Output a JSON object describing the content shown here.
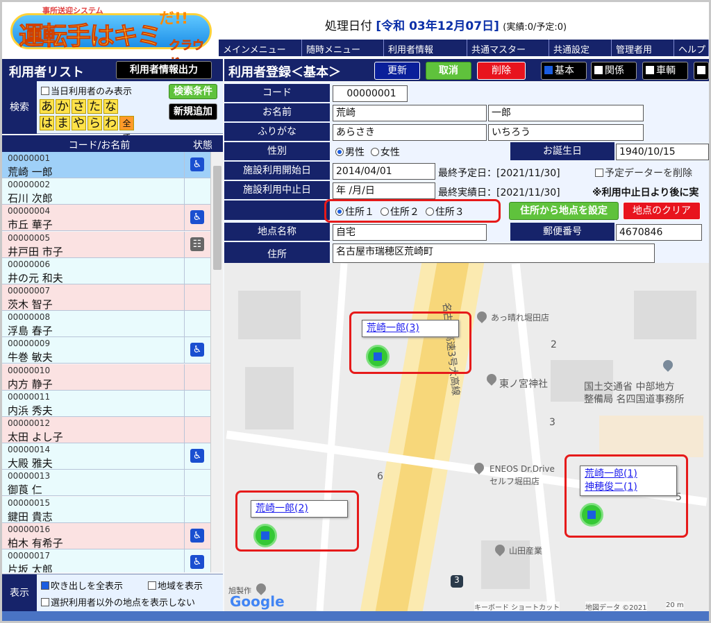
{
  "header": {
    "logo_sub": "事所送迎システム",
    "logo_main": "運転手はキミ",
    "logo_da": "だ!!",
    "logo_cloud": "クラウド",
    "date_label": "処理日付",
    "date_value": "[令和 03年12月07日]",
    "date_stats": "(実績:0/予定:0)"
  },
  "menu": [
    "メインメニュー",
    "随時メニュー",
    "利用者情報",
    "共通マスター",
    "共通設定",
    "管理者用",
    "ヘルプ"
  ],
  "left": {
    "title": "利用者リスト",
    "export_button": "利用者情報出力",
    "search_label": "検索",
    "today_only": "当日利用者のみ表示",
    "kana_row1": [
      "あ",
      "か",
      "さ",
      "た",
      "な"
    ],
    "kana_row2": [
      "は",
      "ま",
      "や",
      "ら",
      "わ",
      "全て"
    ],
    "search_cond_button": "検索条件",
    "new_add_button": "新規追加",
    "col_code_name": "コード/お名前",
    "col_status": "状態",
    "users": [
      {
        "code": "00000001",
        "name": "荒崎 一郎",
        "status": "wheelchair"
      },
      {
        "code": "00000002",
        "name": "石川 次郎",
        "status": ""
      },
      {
        "code": "00000004",
        "name": "市丘 華子",
        "status": "wheelchair"
      },
      {
        "code": "00000005",
        "name": "井戸田 市子",
        "status": "walker"
      },
      {
        "code": "00000006",
        "name": "井の元 和夫",
        "status": ""
      },
      {
        "code": "00000007",
        "name": "茨木 智子",
        "status": ""
      },
      {
        "code": "00000008",
        "name": "浮島 春子",
        "status": ""
      },
      {
        "code": "00000009",
        "name": "牛巻 敏夫",
        "status": "wheelchair"
      },
      {
        "code": "00000010",
        "name": "内方 静子",
        "status": ""
      },
      {
        "code": "00000011",
        "name": "内浜 秀夫",
        "status": ""
      },
      {
        "code": "00000012",
        "name": "太田 よし子",
        "status": ""
      },
      {
        "code": "00000014",
        "name": "大殿 雅夫",
        "status": "wheelchair"
      },
      {
        "code": "00000013",
        "name": "御莨 仁",
        "status": ""
      },
      {
        "code": "00000015",
        "name": "鍵田 貴志",
        "status": ""
      },
      {
        "code": "00000016",
        "name": "柏木 有希子",
        "status": "wheelchair"
      },
      {
        "code": "00000017",
        "name": "片坂 太郎",
        "status": "wheelchair"
      }
    ],
    "display_label": "表示",
    "show_all_balloons": "吹き出しを全表示",
    "show_area": "地域を表示",
    "hide_others": "選択利用者以外の地点を表示しない"
  },
  "right": {
    "title": "利用者登録＜基本＞",
    "update_button": "更新",
    "cancel_button": "取消",
    "delete_button": "削除",
    "tab_basic": "基本",
    "tab_relation": "関係",
    "tab_vehicle": "車輌",
    "form": {
      "code_label": "コード",
      "code_value": "00000001",
      "name_label": "お名前",
      "last_name": "荒崎",
      "first_name": "一郎",
      "kana_label": "ふりがな",
      "last_kana": "あらさき",
      "first_kana": "いちろう",
      "gender_label": "性別",
      "male": "男性",
      "female": "女性",
      "birthday_label": "お誕生日",
      "birthday_value": "1940/10/15",
      "start_label": "施設利用開始日",
      "start_value": "2014/04/01",
      "last_planned": "最終予定日：[2021/11/30]",
      "delete_planned": "予定データーを削除",
      "stop_label": "施設利用中止日",
      "stop_value": "年 /月/日",
      "last_actual": "最終実績日：[2021/11/30]",
      "stop_note": "※利用中止日より後に実",
      "address1": "住所１",
      "address2": "住所２",
      "address3": "住所３",
      "set_point_button": "住所から地点を設定",
      "clear_point_button": "地点のクリア",
      "place_label": "地点名称",
      "place_value": "自宅",
      "zip_label": "郵便番号",
      "zip_value": "4670846",
      "address_label": "住所",
      "address_value": "名古屋市瑞穂区荒崎町"
    }
  },
  "map": {
    "balloon1": "荒崎一郎(3)",
    "balloon2": "荒崎一郎(2)",
    "balloon3a": "荒崎一郎(1)",
    "balloon3b": "神穂俊二(1)",
    "poi_store": "あっ晴れ堀田店",
    "poi_shrine": "東ノ宮神社",
    "poi_office1": "国土交通省 中部地方",
    "poi_office2": "整備局 名四国道事務所",
    "poi_eneos1": "ENEOS Dr.Drive",
    "poi_eneos2": "セルフ堀田店",
    "poi_yamada": "山田産業",
    "road_label": "名古屋高速3号大高線",
    "block_2": "2",
    "block_3": "3",
    "block_6": "6",
    "block_5": "5",
    "route_3": "3",
    "credit_maker": "旭製作",
    "google": "Google",
    "shortcut": "キーボード ショートカット",
    "map_data": "地図データ ©2021",
    "scale": "20 m"
  }
}
